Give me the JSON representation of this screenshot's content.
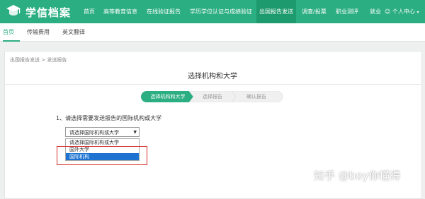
{
  "header": {
    "brand": "学信档案",
    "nav": [
      {
        "label": "首页"
      },
      {
        "label": "高等教育信息"
      },
      {
        "label": "在线验证报告"
      },
      {
        "label": "学历学位认证与成绩验证"
      },
      {
        "label": "出国报告发送"
      },
      {
        "label": "调查/投票"
      },
      {
        "label": "职业测评"
      },
      {
        "label": "就业"
      }
    ],
    "active_nav": "出国报告发送",
    "user_menu": "个人中心",
    "accent_color": "#2bae82"
  },
  "subnav": {
    "items": [
      {
        "label": "首页"
      },
      {
        "label": "传输费用"
      },
      {
        "label": "英文翻译"
      }
    ],
    "active": "首页"
  },
  "breadcrumb": "出国报告发送 > 发送报告",
  "page_title": "选择机构和大学",
  "steps": [
    {
      "label": "选择机构和大学",
      "state": "active"
    },
    {
      "label": "选择报告",
      "state": "pending"
    },
    {
      "label": "确认报告",
      "state": "pending"
    }
  ],
  "form": {
    "question": "1、请选择需要发送报告的国际机构或大学",
    "select": {
      "value": "请选择国际机构或大学",
      "options": [
        "请选择国际机构或大学",
        "国外大学",
        "国际机构"
      ],
      "highlighted": "国际机构"
    }
  },
  "watermark": "知乎 @boy你懂得"
}
